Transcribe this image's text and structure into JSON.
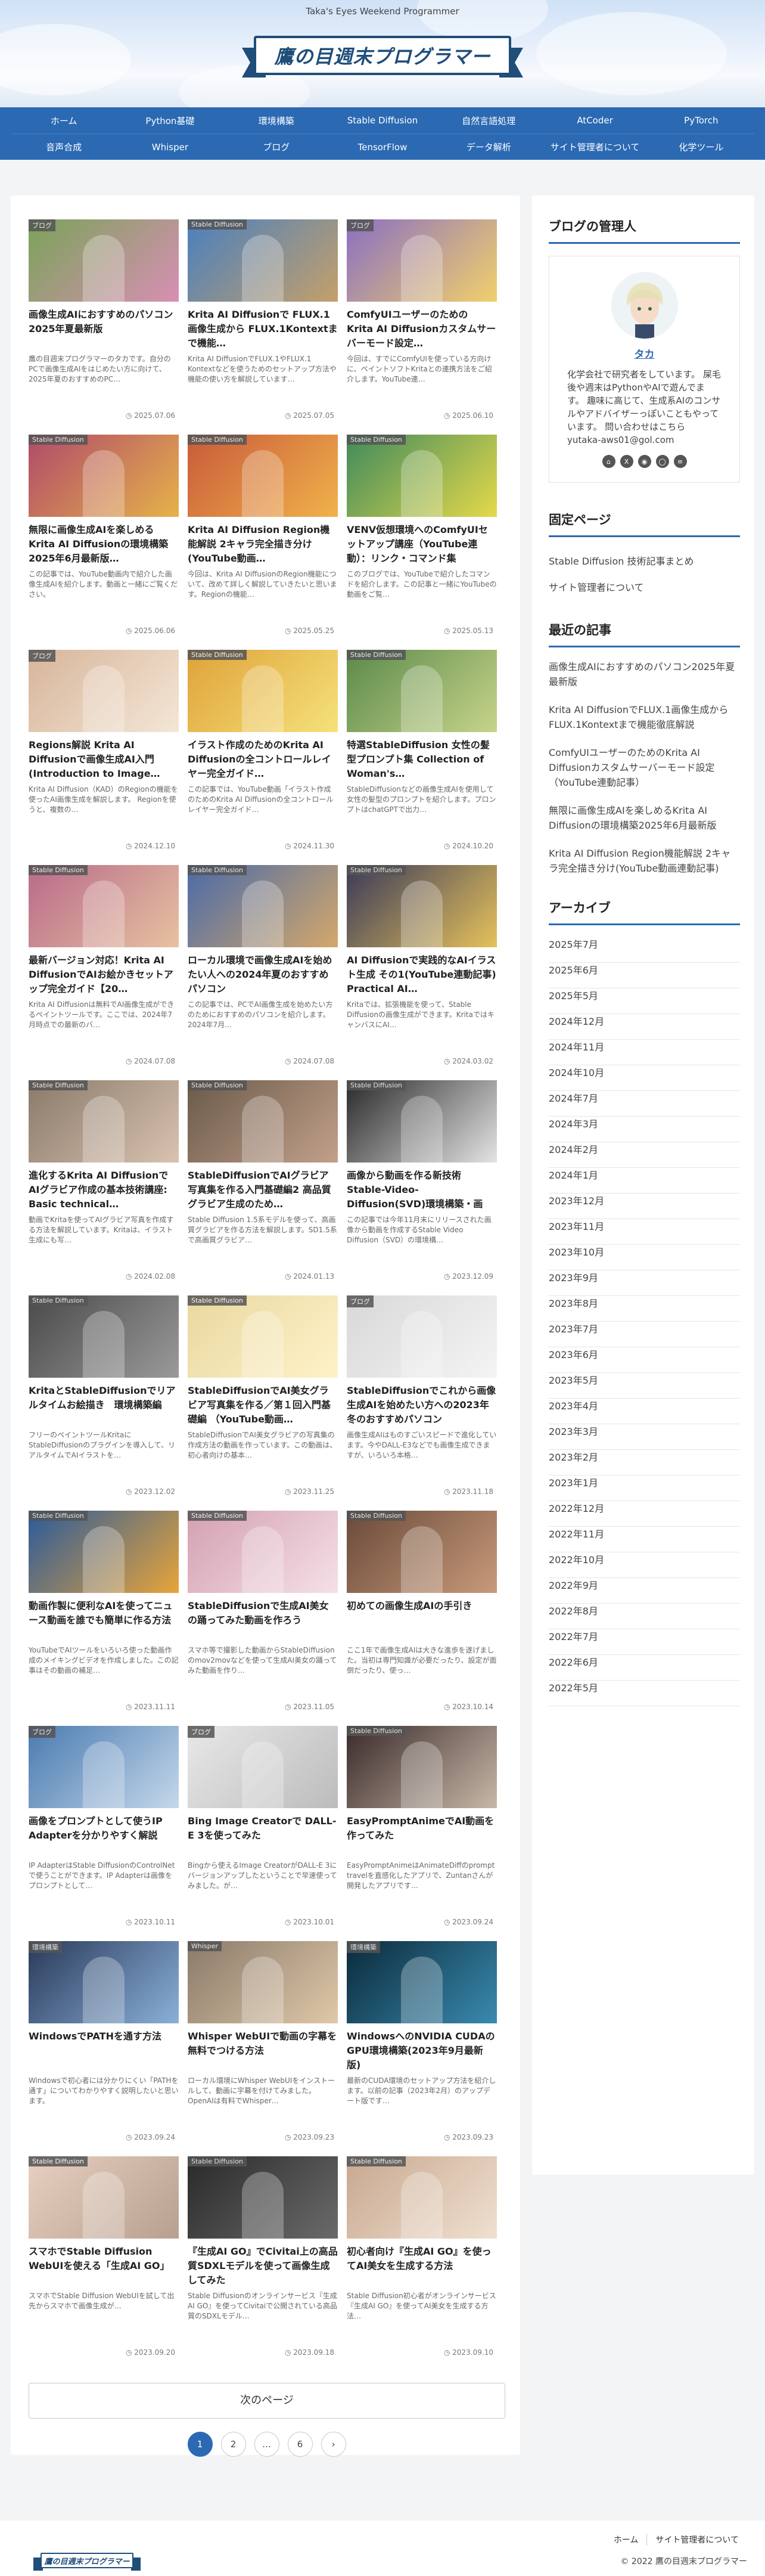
{
  "header": {
    "tagline": "Taka's Eyes Weekend Programmer",
    "site_title": "鷹の目週末プログラマー"
  },
  "nav": {
    "row1": [
      "ホーム",
      "Python基礎",
      "環境構築",
      "Stable Diffusion",
      "自然言語処理",
      "AtCoder",
      "PyTorch"
    ],
    "row2": [
      "音声合成",
      "Whisper",
      "ブログ",
      "TensorFlow",
      "データ解析",
      "サイト管理者について",
      "化学ツール"
    ]
  },
  "cards": [
    {
      "cat": "ブログ",
      "title": "画像生成AIにおすすめのパソコン2025年夏最新版",
      "excerpt": "鷹の目週末プログラマーのタカです。自分のPCで画像生成AIをはじめたい方に向けて、2025年夏のおすすめのPC…",
      "date": "2025.07.06",
      "colors": [
        "#7aa35a",
        "#d88fb3"
      ]
    },
    {
      "cat": "Stable Diffusion",
      "title": "Krita AI Diffusionで FLUX.1画像生成から FLUX.1Kontextまで機能…",
      "excerpt": "Krita AI DiffusionでFLUX.1やFLUX.1 Kontextなどを使うためのセットアップ方法や機能の使い方を解説しています…",
      "date": "2025.07.05",
      "colors": [
        "#4a7fbf",
        "#c4a06a"
      ]
    },
    {
      "cat": "ブログ",
      "title": "ComfyUIユーザーのための Krita AI Diffusionカスタムサーバーモード設定…",
      "excerpt": "今回は、すでにComfyUIを使っている方向けに、ペイントソフトKritaとの連携方法をご紹介します。YouTube連…",
      "date": "2025.06.10",
      "colors": [
        "#8a6fc2",
        "#f2d06b"
      ]
    },
    {
      "cat": "Stable Diffusion",
      "title": "無限に画像生成AIを楽しめる Krita AI Diffusionの環境構築2025年6月最新版…",
      "excerpt": "この記事では、YouTube動画内で紹介した画像生成AIを紹介します。動画と一緒にご覧ください。",
      "date": "2025.06.06",
      "colors": [
        "#b04a6a",
        "#e6b24a"
      ]
    },
    {
      "cat": "Stable Diffusion",
      "title": "Krita AI Diffusion Region機能解説 2キャラ完全描き分け(YouTube動画…",
      "excerpt": "今回は、Krita AI DiffusionのRegion機能について、改めて詳しく解説していきたいと思います。Regionの機能…",
      "date": "2025.05.25",
      "colors": [
        "#c95a3a",
        "#f0b24a"
      ]
    },
    {
      "cat": "Stable Diffusion",
      "title": "VENV仮想環境へのComfyUIセットアップ講座（YouTube連動）：リンク・コマンド集",
      "excerpt": "このブログでは、YouTubeで紹介したコマンドを紹介します。この記事と一緒にYouTubeの動画をご覧…",
      "date": "2025.05.13",
      "colors": [
        "#3f8a5c",
        "#e5d94a"
      ]
    },
    {
      "cat": "ブログ",
      "title": "Regions解説 Krita AI Diffusionで画像生成AI入門(Introduction to Image…",
      "excerpt": "Krita AI Diffusion（KAD）のRegionの機能を使ったAI画像生成を解説します。 Regionを使うと、複数の…",
      "date": "2024.12.10",
      "colors": [
        "#d7b59a",
        "#f4e6d6"
      ]
    },
    {
      "cat": "Stable Diffusion",
      "title": "イラスト作成のためのKrita AI Diffusionの全コントロールレイヤー完全ガイド…",
      "excerpt": "この記事では、YouTube動画「イラスト作成のためのKrita AI Diffusionの全コントロールレイヤー完全ガイド…",
      "date": "2024.11.30",
      "colors": [
        "#e0a23a",
        "#f5e27a"
      ]
    },
    {
      "cat": "Stable Diffusion",
      "title": "特選StableDiffusion 女性の髪型プロンプト集 Collection of Woman's…",
      "excerpt": "StableDiffusionなどの画像生成AIを使用して女性の髪型のプロンプトを紹介します。プロンプトはchatGPTで出力…",
      "date": "2024.10.20",
      "colors": [
        "#5a8a4a",
        "#c7d48a"
      ]
    },
    {
      "cat": "Stable Diffusion",
      "title": "最新バージョン対応！Krita AI DiffusionでAIお絵かきセットアップ完全ガイド【20…",
      "excerpt": "Krita AI Diffusionは無料でAI画像生成ができるペイントツールです。ここでは、2024年7月時点での最新のバ…",
      "date": "2024.07.08",
      "colors": [
        "#b86a8a",
        "#e7c2a0"
      ]
    },
    {
      "cat": "Stable Diffusion",
      "title": "ローカル環境で画像生成AIを始めたい人への2024年夏のおすすめパソコン",
      "excerpt": "この記事では、PCでAI画像生成を始めたい方のためにおすすめのパソコンを紹介します。2024年7月…",
      "date": "2024.07.08",
      "colors": [
        "#4a6aa8",
        "#d4a86a"
      ]
    },
    {
      "cat": "Stable Diffusion",
      "title": "AI Diffusionで実践的なAIイラスト生成 その1(YouTube連動記事) Practical AI…",
      "excerpt": "Kritaでは、拡張機能を使って、Stable Diffusionの画像生成ができます。KritaではキャンバスにAI…",
      "date": "2024.03.02",
      "colors": [
        "#3a3a5a",
        "#e6c25a"
      ]
    },
    {
      "cat": "Stable Diffusion",
      "title": "進化するKrita AI Diffusionで AIグラビア作成の基本技術講座: Basic technical…",
      "excerpt": "動画でKritaを使ってAIグラビア写真を作成する方法を解説しています。Kritaは、イラスト生成にも写…",
      "date": "2024.02.08",
      "colors": [
        "#8a7a6a",
        "#d9c2b0"
      ]
    },
    {
      "cat": "Stable Diffusion",
      "title": "StableDiffusionでAIグラビア写真集を作る入門基礎編2 高品質グラビア生成のため…",
      "excerpt": "Stable Diffusion 1.5系モデルを使って、高画質グラビアを作る方法を解説します。SD1.5系で高画質グラビア…",
      "date": "2024.01.13",
      "colors": [
        "#6a5a4a",
        "#c2a08a"
      ]
    },
    {
      "cat": "Stable Diffusion",
      "title": "画像から動画を作る新技術 Stable-Video-Diffusion(SVD)環境構築・画像…",
      "excerpt": "この記事では今年11月末にリリースされた画像から動画を作成するStable Video Diffusion（SVD）の環境構…",
      "date": "2023.12.09",
      "colors": [
        "#2a2a2a",
        "#e4e4e4"
      ]
    },
    {
      "cat": "Stable Diffusion",
      "title": "KritaとStableDiffusionでリアルタイムお絵描き　環境構築編",
      "excerpt": "フリーのペイントツールKritaにStableDiffusionのプラグインを導入して、リアルタイムでAIイラストを…",
      "date": "2023.12.02",
      "colors": [
        "#4a4a4a",
        "#9a9a9a"
      ]
    },
    {
      "cat": "Stable Diffusion",
      "title": "StableDiffusionでAI美女グラビア写真集を作る／第１回入門基礎編 （YouTube動画…",
      "excerpt": "StableDiffusionでAI美女グラビアの写真集の作成方法の動画を作っています。この動画は、初心者向けの基本…",
      "date": "2023.11.25",
      "colors": [
        "#e8d8a0",
        "#fff2c8"
      ]
    },
    {
      "cat": "ブログ",
      "title": "StableDiffusionでこれから画像生成AIを始めたい方への2023年冬のおすすめパソコン",
      "excerpt": "画像生成AIはものすごいスピードで進化しています。今やDALL-E3などでも画像生成できますが、いろいろ本格…",
      "date": "2023.11.18",
      "colors": [
        "#d8d8d8",
        "#f4f4f4"
      ]
    },
    {
      "cat": "Stable Diffusion",
      "title": "動画作製に便利なAIを使ってニュース動画を誰でも簡単に作る方法",
      "excerpt": "YouTubeでAIツールをいろいろ使った動画作成のメイキングビデオを作成しました。この記事はその動画の補足…",
      "date": "2023.11.11",
      "colors": [
        "#2a5a9a",
        "#e8a43a"
      ]
    },
    {
      "cat": "Stable Diffusion",
      "title": "StableDiffusionで生成AI美女の踊ってみた動画を作ろう",
      "excerpt": "スマホ等で撮影した動画からStableDiffusionのmov2movなどを使って生成AI美女の踊ってみた動画を作り…",
      "date": "2023.11.05",
      "colors": [
        "#d4a0b0",
        "#f4e0e8"
      ]
    },
    {
      "cat": "Stable Diffusion",
      "title": "初めての画像生成AIの手引き",
      "excerpt": "ここ1年で画像生成AIは大きな進歩を遂げました。当初は専門知識が必要だったり、設定が面倒だったり、使っ…",
      "date": "2023.10.14",
      "colors": [
        "#6a4a3a",
        "#c89a7a"
      ]
    },
    {
      "cat": "ブログ",
      "title": "画像をプロンプトとして使うIP Adapterを分かりやすく解説",
      "excerpt": "IP AdapterはStable DiffusionのControlNetで使うことができます。IP Adapterは画像をプロンプトとして…",
      "date": "2023.10.11",
      "colors": [
        "#4a7ab0",
        "#c4d8ea"
      ]
    },
    {
      "cat": "ブログ",
      "title": "Bing Image Creatorで DALL-E 3を使ってみた",
      "excerpt": "Bingから使えるImage CreatorがDALL-E 3にバージョンアップしたということで早速使ってみました。が…",
      "date": "2023.10.01",
      "colors": [
        "#e8e8e8",
        "#bcbcbc"
      ]
    },
    {
      "cat": "Stable Diffusion",
      "title": "EasyPromptAnimeでAI動画を作ってみた",
      "excerpt": "EasyPromptAnimeはAnimateDiffのprompt travelを直感化したアプリで、Zuntanさんが開発したアプリです…",
      "date": "2023.09.24",
      "colors": [
        "#3a2a2a",
        "#c8b8a8"
      ]
    },
    {
      "cat": "環境構築",
      "title": "WindowsでPATHを通す方法",
      "excerpt": "Windowsで初心者には分かりにくい「PATHを通す」についてわかりやすく説明したいと思います。",
      "date": "2023.09.24",
      "colors": [
        "#2a3a5a",
        "#8ab0d8"
      ]
    },
    {
      "cat": "Whisper",
      "title": "Whisper WebUIで動画の字幕を無料でつける方法",
      "excerpt": "ローカル環境にWhisper WebUIをインストールして、動画に字幕を付けてみました。OpenAIは有料でWhisper…",
      "date": "2023.09.23",
      "colors": [
        "#8a7a6a",
        "#e0c8a8"
      ]
    },
    {
      "cat": "環境構築",
      "title": "WindowsへのNVIDIA CUDAのGPU環境構築(2023年9月最新版)",
      "excerpt": "最新のCUDA環境のセットアップ方法を紹介します。以前の記事（2023年2月）のアップデート版です…",
      "date": "2023.09.23",
      "colors": [
        "#0a2a3a",
        "#3a8ab0"
      ]
    },
    {
      "cat": "Stable Diffusion",
      "title": "スマホでStable Diffusion WebUIを使える「生成AI GO」",
      "excerpt": "スマホでStable Diffusion WebUIを試して出先からスマホで画像生成が…",
      "date": "2023.09.20",
      "colors": [
        "#e8d0c0",
        "#b8a090"
      ]
    },
    {
      "cat": "Stable Diffusion",
      "title": "『生成AI GO』でCivitai上の高品質SDXLモデルを使って画像生成してみた",
      "excerpt": "Stable Diffusionのオンラインサービス『生成AI GO』を使ってCivitaiで公開されている高品質のSDXLモデル…",
      "date": "2023.09.18",
      "colors": [
        "#2a2a2a",
        "#6a6a6a"
      ]
    },
    {
      "cat": "Stable Diffusion",
      "title": "初心者向け『生成AI GO』を使ってAI美女を生成する方法",
      "excerpt": "Stable Diffusion初心者がオンラインサービス『生成AI GO』を使ってAI美女を生成する方法…",
      "date": "2023.09.10",
      "colors": [
        "#c8a890",
        "#f0e0d0"
      ]
    }
  ],
  "next_label": "次のページ",
  "pager": [
    "1",
    "2",
    "…",
    "6",
    "›"
  ],
  "sidebar": {
    "admin_heading": "ブログの管理人",
    "admin_name": "タカ",
    "admin_desc": "化学会社で研究者をしています。 屎毛後や週末はPythonやAIで遊んでます。 趣味に高じて、生成系AIのコンサルやアドバイザーっぽいこともやっています。 問い合わせはこちら yutaka-aws01@gol.com",
    "social": [
      "⌂",
      "X",
      "◉",
      "◯",
      "≡"
    ],
    "fixed_heading": "固定ページ",
    "fixed": [
      "Stable Diffusion 技術記事まとめ",
      "サイト管理者について"
    ],
    "recent_heading": "最近の記事",
    "recent": [
      "画像生成AIにおすすめのパソコン2025年夏最新版",
      "Krita AI DiffusionでFLUX.1画像生成からFLUX.1Kontextまで機能徹底解説",
      "ComfyUIユーザーのためのKrita AI Diffusionカスタムサーバーモード設定（YouTube連動記事）",
      "無限に画像生成AIを楽しめるKrita AI Diffusionの環境構築2025年6月最新版",
      "Krita AI Diffusion Region機能解説 2キャラ完全描き分け(YouTube動画連動記事)"
    ],
    "archive_heading": "アーカイブ",
    "archive": [
      "2025年7月",
      "2025年6月",
      "2025年5月",
      "2024年12月",
      "2024年11月",
      "2024年10月",
      "2024年7月",
      "2024年3月",
      "2024年2月",
      "2024年1月",
      "2023年12月",
      "2023年11月",
      "2023年10月",
      "2023年9月",
      "2023年8月",
      "2023年7月",
      "2023年6月",
      "2023年5月",
      "2023年4月",
      "2023年3月",
      "2023年2月",
      "2023年1月",
      "2022年12月",
      "2022年11月",
      "2022年10月",
      "2022年9月",
      "2022年8月",
      "2022年7月",
      "2022年6月",
      "2022年5月"
    ]
  },
  "footer": {
    "links": [
      "ホーム",
      "サイト管理者について"
    ],
    "copyright": "© 2022 鷹の目週末プログラマー",
    "logo_text": "鷹の目週末プログラマー"
  }
}
